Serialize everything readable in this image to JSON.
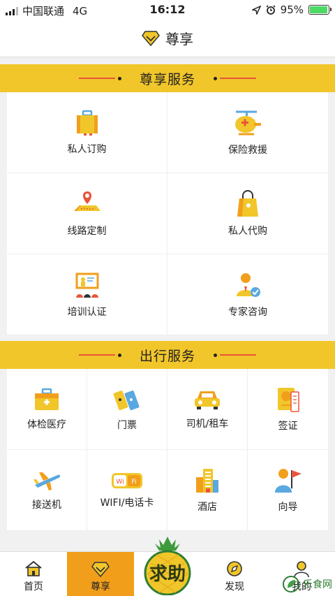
{
  "status_bar": {
    "carrier": "中国联通",
    "network": "4G",
    "time": "16:12",
    "battery": "95%",
    "battery_level": 0.95
  },
  "nav": {
    "title": "尊享"
  },
  "section1": {
    "title": "尊享服务",
    "items": [
      {
        "label": "私人订购",
        "icon": "suitcase-icon"
      },
      {
        "label": "保险救援",
        "icon": "rescue-helicopter-icon"
      },
      {
        "label": "线路定制",
        "icon": "route-map-icon"
      },
      {
        "label": "私人代购",
        "icon": "shopping-bag-icon"
      },
      {
        "label": "培训认证",
        "icon": "training-board-icon"
      },
      {
        "label": "专家咨询",
        "icon": "expert-icon"
      }
    ]
  },
  "section2": {
    "title": "出行服务",
    "items": [
      {
        "label": "体检医疗",
        "icon": "medical-kit-icon"
      },
      {
        "label": "门票",
        "icon": "ticket-icon"
      },
      {
        "label": "司机/租车",
        "icon": "car-icon"
      },
      {
        "label": "签证",
        "icon": "passport-icon"
      },
      {
        "label": "接送机",
        "icon": "airplane-icon"
      },
      {
        "label": "WIFI/电话卡",
        "icon": "wifi-card-icon"
      },
      {
        "label": "酒店",
        "icon": "hotel-icon"
      },
      {
        "label": "向导",
        "icon": "guide-flag-icon"
      }
    ]
  },
  "tabs": [
    {
      "label": "首页",
      "icon": "home-icon"
    },
    {
      "label": "尊享",
      "icon": "diamond-icon",
      "active": true
    },
    {
      "label": "",
      "icon": "help-badge"
    },
    {
      "label": "发现",
      "icon": "compass-icon"
    },
    {
      "label": "我的",
      "icon": "profile-icon"
    }
  ],
  "help_badge": {
    "text": "求助"
  },
  "watermark": {
    "text": "乐食网"
  },
  "colors": {
    "accent": "#f1c62a",
    "orange": "#f19f1b",
    "red": "#e8553a",
    "blue": "#5aa8e0"
  }
}
